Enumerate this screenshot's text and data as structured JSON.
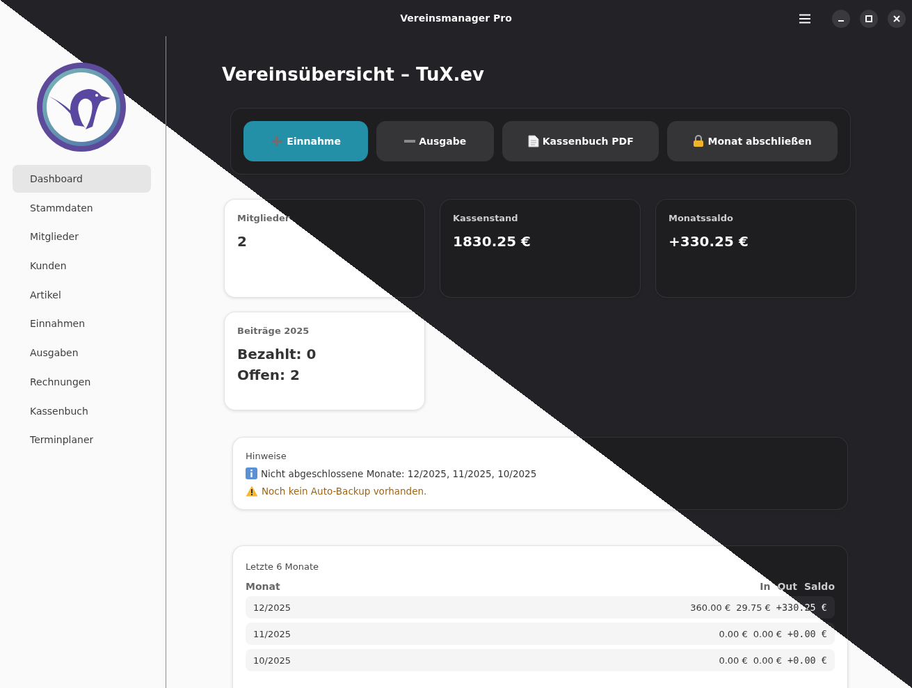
{
  "window": {
    "title": "Vereinsmanager Pro"
  },
  "sidebar": {
    "items": [
      {
        "label": "Dashboard",
        "selected": true
      },
      {
        "label": "Stammdaten",
        "selected": false
      },
      {
        "label": "Mitglieder",
        "selected": false
      },
      {
        "label": "Kunden",
        "selected": false
      },
      {
        "label": "Artikel",
        "selected": false
      },
      {
        "label": "Einnahmen",
        "selected": false
      },
      {
        "label": "Ausgaben",
        "selected": false
      },
      {
        "label": "Rechnungen",
        "selected": false
      },
      {
        "label": "Kassenbuch",
        "selected": false
      },
      {
        "label": "Terminplaner",
        "selected": false
      }
    ]
  },
  "page": {
    "title": "Vereinsübersicht – TuX.ev"
  },
  "actions": [
    {
      "kind": "income",
      "label": "Einnahme",
      "primary": true
    },
    {
      "kind": "expense",
      "label": "Ausgabe",
      "primary": false
    },
    {
      "kind": "pdf",
      "label": "Kassenbuch PDF",
      "primary": false
    },
    {
      "kind": "lock",
      "label": "Monat abschließen",
      "primary": false
    }
  ],
  "stats": [
    {
      "label": "Mitglieder",
      "lines": [
        "2"
      ]
    },
    {
      "label": "Kassenstand",
      "lines": [
        "1830.25 €"
      ]
    },
    {
      "label": "Monatssaldo",
      "lines": [
        "+330.25 €"
      ]
    },
    {
      "label": "Beiträge 2025",
      "lines": [
        "Bezahlt: 0",
        "Offen: 2"
      ]
    }
  ],
  "notices": {
    "title": "Hinweise",
    "items": [
      {
        "kind": "info",
        "text": "Nicht abgeschlossene Monate: 12/2025, 11/2025, 10/2025"
      },
      {
        "kind": "warning",
        "text": "Noch kein Auto-Backup vorhanden."
      }
    ]
  },
  "months": {
    "title": "Letzte 6 Monate",
    "columns": [
      "Monat",
      "In",
      "Out",
      "Saldo"
    ],
    "rows": [
      {
        "month": "12/2025",
        "in": "360.00 €",
        "out": "29.75 €",
        "saldo": "+330.25 €"
      },
      {
        "month": "11/2025",
        "in": "0.00 €",
        "out": "0.00 €",
        "saldo": "+0.00 €"
      },
      {
        "month": "10/2025",
        "in": "0.00 €",
        "out": "0.00 €",
        "saldo": "+0.00 €"
      }
    ]
  }
}
